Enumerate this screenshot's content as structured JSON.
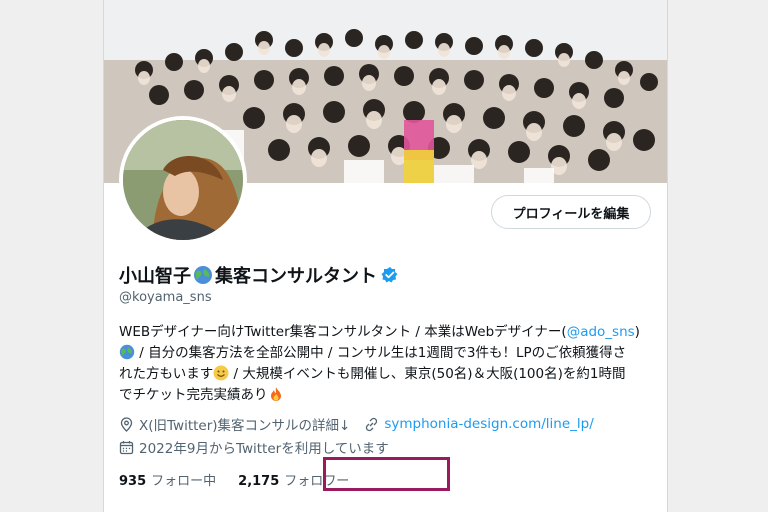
{
  "profile": {
    "name": "小山智子",
    "name_suffix": "集客コンサルタント",
    "handle": "@koyama_sns",
    "edit_button": "プロフィールを編集",
    "bio": {
      "line1_a": "WEBデザイナー向けTwitter集客コンサルタント / 本業はWebデザイナー(",
      "line1_link": "@ado_sns",
      "line1_b": ")",
      "line2": " / 自分の集客方法を全部公開中 / コンサル生は1週間で3件も！LPのご依頼獲得さ",
      "line3_a": "れた方もいます",
      "line3_b": " / 大規模イベントも開催し、東京(50名)＆大阪(100名)を約1時間",
      "line4": "でチケット完売実績あり"
    },
    "location_text": "X(旧Twitter)集客コンサルの詳細↓",
    "website": "symphonia-design.com/line_lp/",
    "joined": "2022年9月からTwitterを利用しています",
    "following_count": "935",
    "following_label": "フォロー中",
    "followers_count": "2,175",
    "followers_label": "フォロワー"
  },
  "icons": {
    "globe": "globe-emoji-icon",
    "verified": "verified-badge-icon",
    "location": "location-pin-icon",
    "link": "link-icon",
    "calendar": "calendar-icon",
    "smile": "smiling-face-emoji-icon",
    "fire": "fire-emoji-icon"
  },
  "colors": {
    "link": "#1d9bf0",
    "secondary_text": "#536471",
    "highlight_box": "#9a1a5e",
    "verified": "#1d9bf0"
  }
}
